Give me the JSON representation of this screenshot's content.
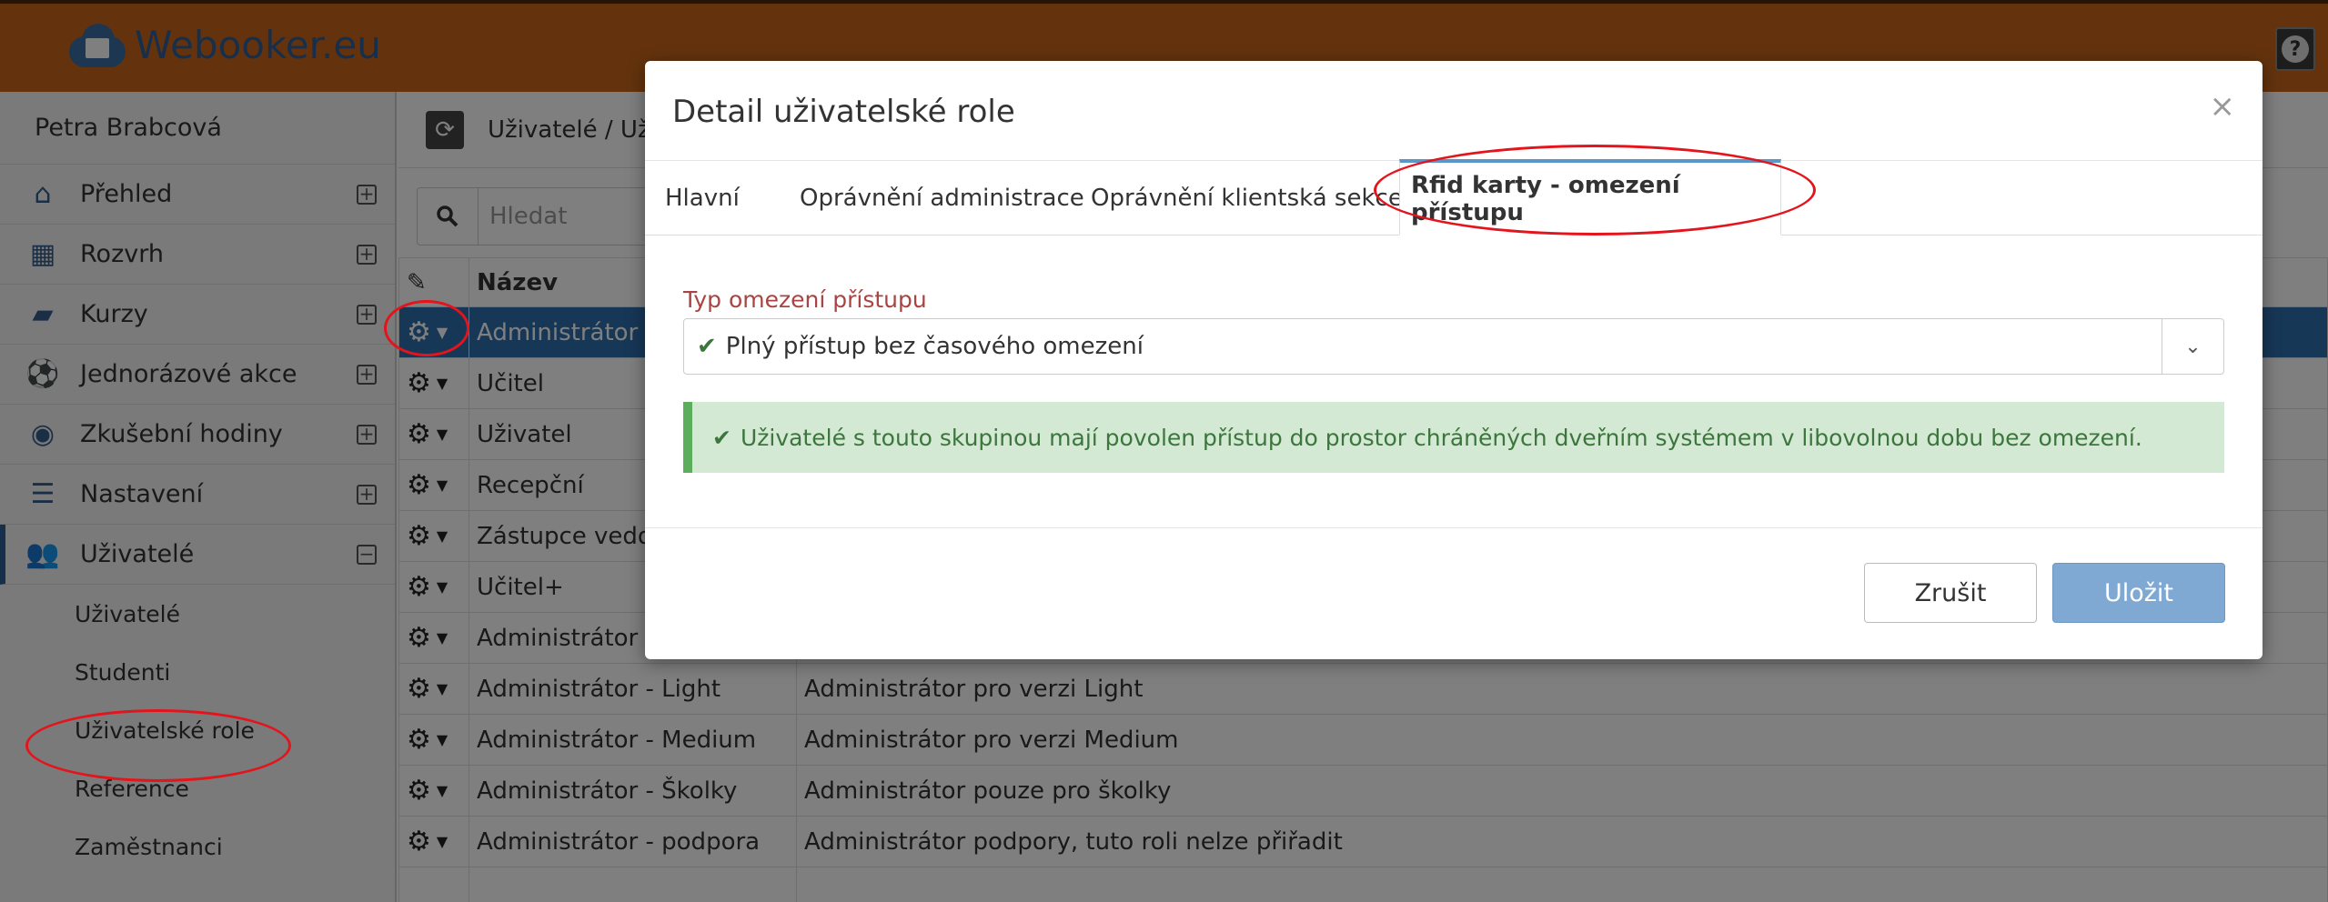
{
  "app": {
    "logo_text": "Webooker.eu",
    "help_label": "?"
  },
  "sidebar": {
    "user_name": "Petra Brabcová",
    "items": [
      {
        "label": "Přehled",
        "icon": "home-icon"
      },
      {
        "label": "Rozvrh",
        "icon": "calendar-icon"
      },
      {
        "label": "Kurzy",
        "icon": "book-icon"
      },
      {
        "label": "Jednorázové akce",
        "icon": "ball-icon"
      },
      {
        "label": "Zkušební hodiny",
        "icon": "eye-icon"
      },
      {
        "label": "Nastavení",
        "icon": "settings-icon"
      },
      {
        "label": "Uživatelé",
        "icon": "users-icon"
      }
    ],
    "sub_items": [
      "Uživatelé",
      "Studenti",
      "Uživatelské role",
      "Reference",
      "Zaměstnanci"
    ]
  },
  "main": {
    "breadcrumb": "Uživatelé / Uživ",
    "search_placeholder": "Hledat",
    "table": {
      "header_name": "Název",
      "rows": [
        {
          "name": "Administrátor",
          "desc": ""
        },
        {
          "name": "Učitel",
          "desc": ""
        },
        {
          "name": "Uživatel",
          "desc": ""
        },
        {
          "name": "Recepční",
          "desc": ""
        },
        {
          "name": "Zástupce vedou",
          "desc": ""
        },
        {
          "name": "Učitel+",
          "desc": ""
        },
        {
          "name": "Administrátor -",
          "desc": ""
        },
        {
          "name": "Administrátor - Light",
          "desc": "Administrátor pro verzi Light"
        },
        {
          "name": "Administrátor - Medium",
          "desc": "Administrátor pro verzi Medium"
        },
        {
          "name": "Administrátor - Školky",
          "desc": "Administrátor pouze pro školky"
        },
        {
          "name": "Administrátor - podpora",
          "desc": "Administrátor podpory, tuto roli nelze přiřadit"
        }
      ]
    }
  },
  "modal": {
    "title": "Detail uživatelské role",
    "close": "×",
    "tabs": [
      "Hlavní",
      "Oprávnění administrace",
      "Oprávnění klientská sekce",
      "Rfid karty - omezení přístupu"
    ],
    "field_label": "Typ omezení přístupu",
    "selected_value": "Plný přístup bez časového omezení",
    "alert_text": "Uživatelé s touto skupinou mají povolen přístup do prostor chráněných dveřním systémem v libovolnou dobu bez omezení.",
    "cancel_label": "Zrušit",
    "save_label": "Uložit"
  },
  "colors": {
    "topbar": "#c9661b",
    "brand_blue": "#2f5f97",
    "highlight_red": "#e3141c",
    "success_green": "#3c763d"
  }
}
